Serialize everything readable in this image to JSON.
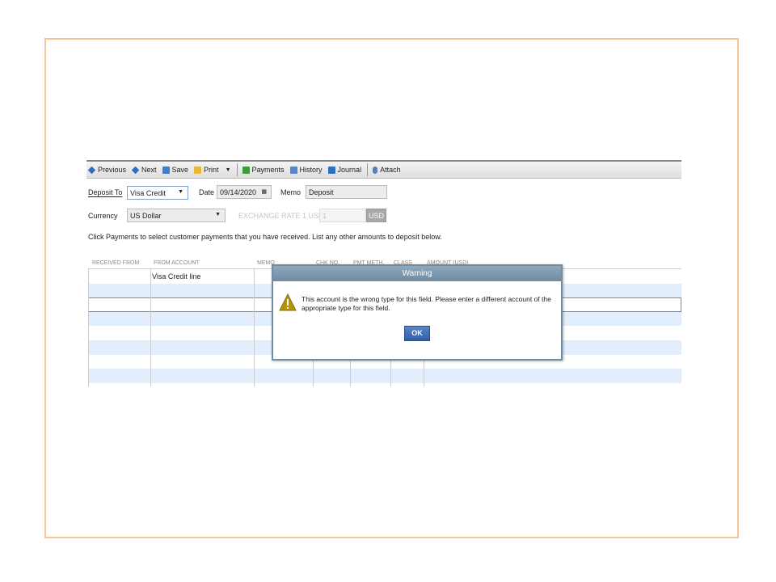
{
  "toolbar": {
    "previous": "Previous",
    "next": "Next",
    "save": "Save",
    "print": "Print",
    "payments": "Payments",
    "history": "History",
    "journal": "Journal",
    "attach": "Attach"
  },
  "form": {
    "deposit_to_label": "Deposit To",
    "deposit_to_value": "Visa Credit",
    "date_label": "Date",
    "date_value": "09/14/2020",
    "memo_label": "Memo",
    "memo_value": "Deposit",
    "currency_label": "Currency",
    "currency_value": "US Dollar",
    "exchange_label": "EXCHANGE RATE 1 USD =",
    "exchange_value": "1",
    "exchange_currency": "USD",
    "instructions": "Click Payments to select customer payments that you have received. List any other amounts to deposit below."
  },
  "table": {
    "columns": [
      "RECEIVED FROM",
      "FROM ACCOUNT",
      "MEMO",
      "CHK NO.",
      "PMT METH.",
      "CLASS",
      "AMOUNT (USD)"
    ],
    "rows": [
      {
        "from_account": "Visa Credit line"
      }
    ]
  },
  "dialog": {
    "title": "Warning",
    "message": "This account is the wrong type for this field. Please enter a different account of the appropriate type for this field.",
    "ok": "OK"
  }
}
